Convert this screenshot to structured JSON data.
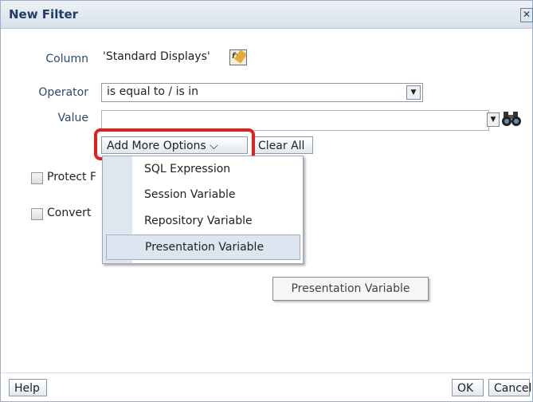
{
  "dialog": {
    "title": "New Filter",
    "close_label": "✕"
  },
  "form": {
    "column_label": "Column",
    "column_value": "'Standard Displays'",
    "operator_label": "Operator",
    "operator_value": "is equal to / is in",
    "value_label": "Value",
    "value_input": ""
  },
  "buttons": {
    "add_more_options": "Add More Options ⌵",
    "clear_all": "Clear All",
    "help": "Help",
    "ok": "OK",
    "cancel": "Cancel"
  },
  "checkboxes": [
    {
      "label": "Protect F",
      "checked": false
    },
    {
      "label": "Convert",
      "checked": false
    }
  ],
  "menu": {
    "items": [
      {
        "label": "SQL Expression"
      },
      {
        "label": "Session Variable"
      },
      {
        "label": "Repository Variable"
      },
      {
        "label": "Presentation Variable",
        "selected": true
      }
    ]
  },
  "tooltip": {
    "text": "Presentation Variable"
  },
  "icons": [
    "close-icon",
    "edit-formula-icon",
    "dropdown-arrow-icon",
    "binoculars-search-icon"
  ],
  "colors": {
    "title_text": "#1f3d66",
    "label_text": "#2b4a6f",
    "highlight_border": "#e0201f"
  }
}
